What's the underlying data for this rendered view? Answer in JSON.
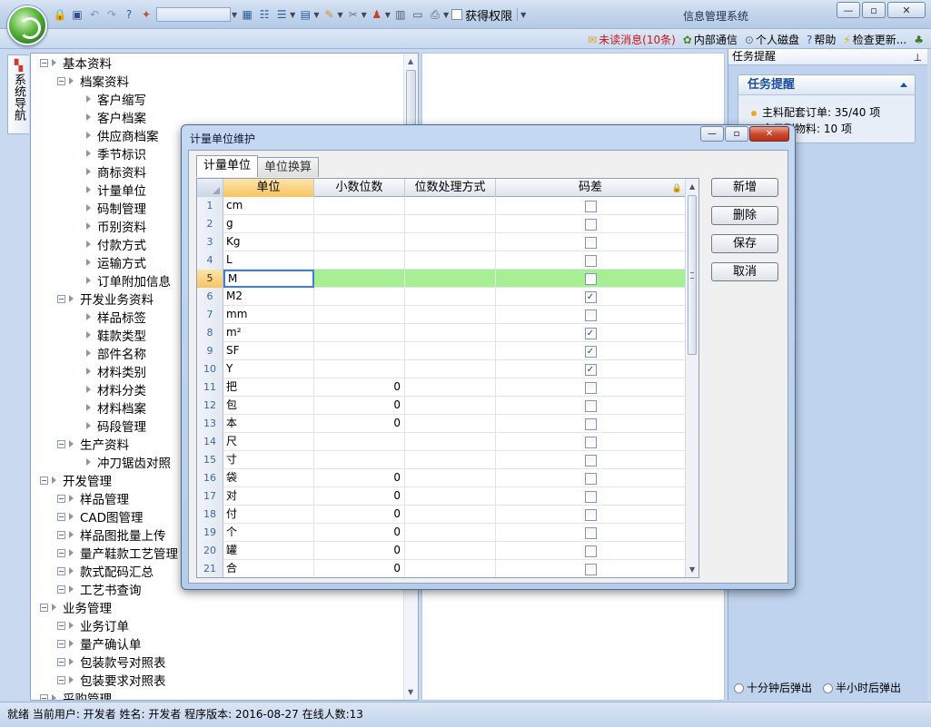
{
  "app": {
    "title": "信息管理系统",
    "permission_label": "获得权限"
  },
  "infobar": {
    "unread": "未读消息(10条)",
    "internal": "内部通信",
    "disk": "个人磁盘",
    "help": "帮助",
    "update": "检查更新..."
  },
  "nav_tab": {
    "label": "系统导航"
  },
  "tree": [
    {
      "level": 0,
      "label": "基本资料"
    },
    {
      "level": 1,
      "label": "档案资料"
    },
    {
      "level": 2,
      "label": "客户缩写"
    },
    {
      "level": 2,
      "label": "客户档案"
    },
    {
      "level": 2,
      "label": "供应商档案"
    },
    {
      "level": 2,
      "label": "季节标识"
    },
    {
      "level": 2,
      "label": "商标资料"
    },
    {
      "level": 2,
      "label": "计量单位"
    },
    {
      "level": 2,
      "label": "码制管理"
    },
    {
      "level": 2,
      "label": "币别资料"
    },
    {
      "level": 2,
      "label": "付款方式"
    },
    {
      "level": 2,
      "label": "运输方式"
    },
    {
      "level": 2,
      "label": "订单附加信息"
    },
    {
      "level": 1,
      "label": "开发业务资料"
    },
    {
      "level": 2,
      "label": "样品标签"
    },
    {
      "level": 2,
      "label": "鞋款类型"
    },
    {
      "level": 2,
      "label": "部件名称"
    },
    {
      "level": 2,
      "label": "材料类别"
    },
    {
      "level": 2,
      "label": "材料分类"
    },
    {
      "level": 2,
      "label": "材料档案"
    },
    {
      "level": 2,
      "label": "码段管理"
    },
    {
      "level": 1,
      "label": "生产资料"
    },
    {
      "level": 2,
      "label": "冲刀锯齿对照"
    },
    {
      "level": 0,
      "label": "开发管理"
    },
    {
      "level": 1,
      "label": "样品管理"
    },
    {
      "level": 1,
      "label": "CAD图管理"
    },
    {
      "level": 1,
      "label": "样品图批量上传"
    },
    {
      "level": 1,
      "label": "量产鞋款工艺管理"
    },
    {
      "level": 1,
      "label": "款式配码汇总"
    },
    {
      "level": 1,
      "label": "工艺书查询"
    },
    {
      "level": 0,
      "label": "业务管理"
    },
    {
      "level": 1,
      "label": "业务订单"
    },
    {
      "level": 1,
      "label": "量产确认单"
    },
    {
      "level": 1,
      "label": "包装款号对照表"
    },
    {
      "level": 1,
      "label": "包装要求对照表"
    },
    {
      "level": 0,
      "label": "采购管理"
    }
  ],
  "task_panel": {
    "header": "任务提醒",
    "box_title": "任务提醒",
    "line1": "主料配套订单: 35/40 项",
    "line2": "今日到物料: 10 项",
    "radio1": "十分钟后弹出",
    "radio2": "半小时后弹出"
  },
  "status": {
    "text": "就绪  当前用户: 开发者 姓名: 开发者 程序版本: 2016-08-27 在线人数:13"
  },
  "dialog": {
    "title": "计量单位维护",
    "tabs": [
      "计量单位",
      "单位换算"
    ],
    "columns": [
      "单位",
      "小数位数",
      "位数处理方式",
      "码差"
    ],
    "rows": [
      {
        "n": "1",
        "unit": "cm",
        "dec": "",
        "chk": false
      },
      {
        "n": "2",
        "unit": "g",
        "dec": "",
        "chk": false
      },
      {
        "n": "3",
        "unit": "Kg",
        "dec": "",
        "chk": false
      },
      {
        "n": "4",
        "unit": "L",
        "dec": "",
        "chk": false
      },
      {
        "n": "5",
        "unit": "M",
        "dec": "",
        "chk": false
      },
      {
        "n": "6",
        "unit": "M2",
        "dec": "",
        "chk": true
      },
      {
        "n": "7",
        "unit": "mm",
        "dec": "",
        "chk": false
      },
      {
        "n": "8",
        "unit": "m²",
        "dec": "",
        "chk": true
      },
      {
        "n": "9",
        "unit": "SF",
        "dec": "",
        "chk": true
      },
      {
        "n": "10",
        "unit": "Y",
        "dec": "",
        "chk": true
      },
      {
        "n": "11",
        "unit": "把",
        "dec": "0",
        "chk": false
      },
      {
        "n": "12",
        "unit": "包",
        "dec": "0",
        "chk": false
      },
      {
        "n": "13",
        "unit": "本",
        "dec": "0",
        "chk": false
      },
      {
        "n": "14",
        "unit": "尺",
        "dec": "",
        "chk": false
      },
      {
        "n": "15",
        "unit": "寸",
        "dec": "",
        "chk": false
      },
      {
        "n": "16",
        "unit": "袋",
        "dec": "0",
        "chk": false
      },
      {
        "n": "17",
        "unit": "对",
        "dec": "0",
        "chk": false
      },
      {
        "n": "18",
        "unit": "付",
        "dec": "0",
        "chk": false
      },
      {
        "n": "19",
        "unit": "个",
        "dec": "0",
        "chk": false
      },
      {
        "n": "20",
        "unit": "罐",
        "dec": "0",
        "chk": false
      },
      {
        "n": "21",
        "unit": "合",
        "dec": "0",
        "chk": false
      }
    ],
    "selected_row": "5",
    "buttons": {
      "add": "新增",
      "delete": "删除",
      "save": "保存",
      "cancel": "取消"
    }
  }
}
